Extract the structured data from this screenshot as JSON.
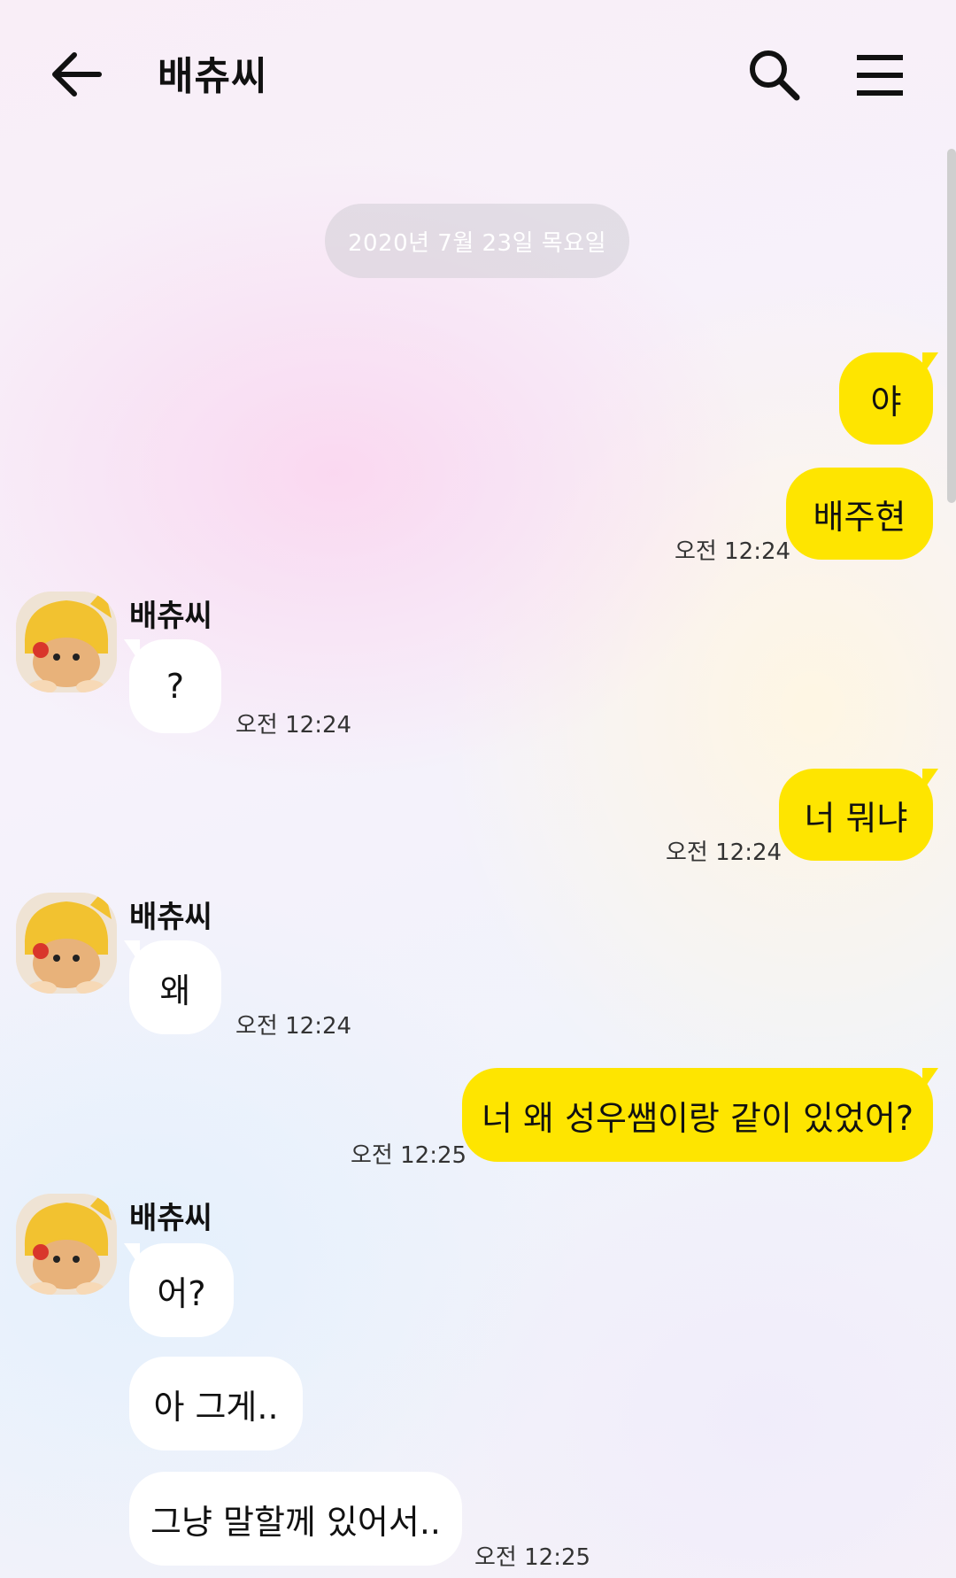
{
  "header": {
    "back_icon": "arrow-left-icon",
    "title": "배츄씨",
    "search_icon": "search-icon",
    "menu_icon": "hamburger-menu-icon"
  },
  "date_divider": "2020년 7월 23일 목요일",
  "colors": {
    "my_bubble": "#fee500",
    "their_bubble": "#ffffff",
    "date_pill": "#d2cdd6"
  },
  "messages": [
    {
      "from": "me",
      "text": "야"
    },
    {
      "from": "me",
      "text": "배주현",
      "time": "오전 12:24"
    },
    {
      "from": "them",
      "sender": "배츄씨",
      "text": "?",
      "time": "오전 12:24"
    },
    {
      "from": "me",
      "text": "너 뭐냐",
      "time": "오전 12:24"
    },
    {
      "from": "them",
      "sender": "배츄씨",
      "text": "왜",
      "time": "오전 12:24"
    },
    {
      "from": "me",
      "text": "너 왜 성우쌤이랑 같이 있었어?",
      "time": "오전 12:25"
    },
    {
      "from": "them",
      "sender": "배츄씨",
      "text": "어?"
    },
    {
      "from": "them",
      "text": "아 그게.."
    },
    {
      "from": "them",
      "text": "그냥 말할께 있어서..",
      "time": "오전 12:25"
    }
  ]
}
